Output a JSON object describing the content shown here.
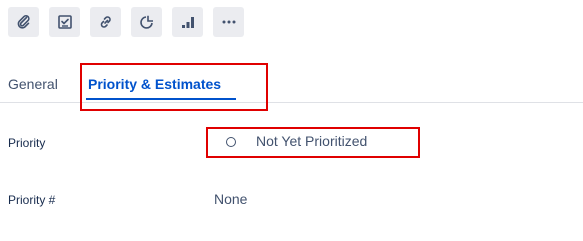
{
  "toolbar": {
    "icons": [
      "attachment-icon",
      "checklist-icon",
      "link-icon",
      "pie-chart-icon",
      "bar-chart-icon",
      "more-icon"
    ]
  },
  "tabs": [
    {
      "label": "General",
      "active": false
    },
    {
      "label": "Priority & Estimates",
      "active": true
    }
  ],
  "fields": {
    "priority": {
      "label": "Priority",
      "value": "Not Yet Prioritized"
    },
    "priority_number": {
      "label": "Priority #",
      "value": "None"
    }
  },
  "colors": {
    "accent": "#0052cc",
    "highlight": "#e00000",
    "button_bg": "#ebecf0",
    "text_muted": "#42526e"
  }
}
